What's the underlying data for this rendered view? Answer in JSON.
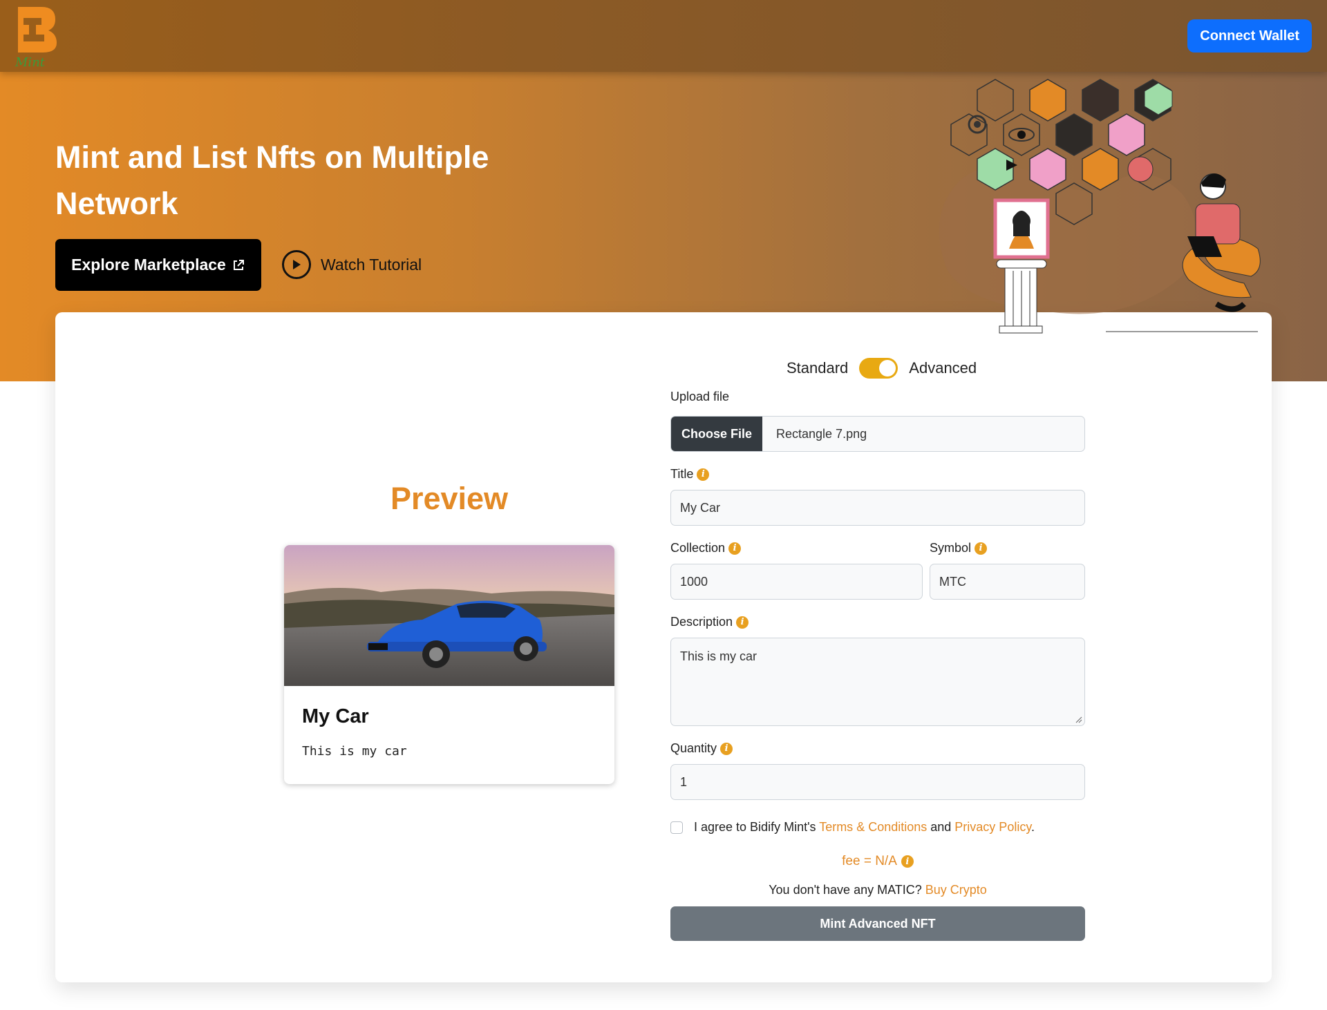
{
  "header": {
    "connect_label": "Connect Wallet"
  },
  "hero": {
    "title": "Mint and List Nfts on Multiple Network",
    "explore_label": "Explore Marketplace",
    "watch_label": "Watch Tutorial"
  },
  "preview": {
    "title": "Preview",
    "nft_title": "My Car",
    "nft_desc": "This is my car"
  },
  "mode": {
    "left": "Standard",
    "right": "Advanced",
    "advanced_on": true
  },
  "form": {
    "upload_label": "Upload file",
    "choose_label": "Choose File",
    "file_name": "Rectangle 7.png",
    "title_label": "Title",
    "title_value": "My Car",
    "collection_label": "Collection",
    "collection_value": "1000",
    "symbol_label": "Symbol",
    "symbol_value": "MTC",
    "description_label": "Description",
    "description_value": "This is my car",
    "quantity_label": "Quantity",
    "quantity_value": "1",
    "agree_prefix": "I agree to Bidify Mint's ",
    "terms_label": "Terms & Conditions",
    "agree_and": " and ",
    "privacy_label": "Privacy Policy",
    "agree_suffix": ".",
    "fee_text": "fee = N/A",
    "matic_text": "You don't have any MATIC? ",
    "buy_label": "Buy Crypto",
    "mint_label": "Mint Advanced NFT"
  },
  "colors": {
    "accent": "#e38a26",
    "primary": "#0d6efd",
    "mint_button": "#6c757d"
  }
}
